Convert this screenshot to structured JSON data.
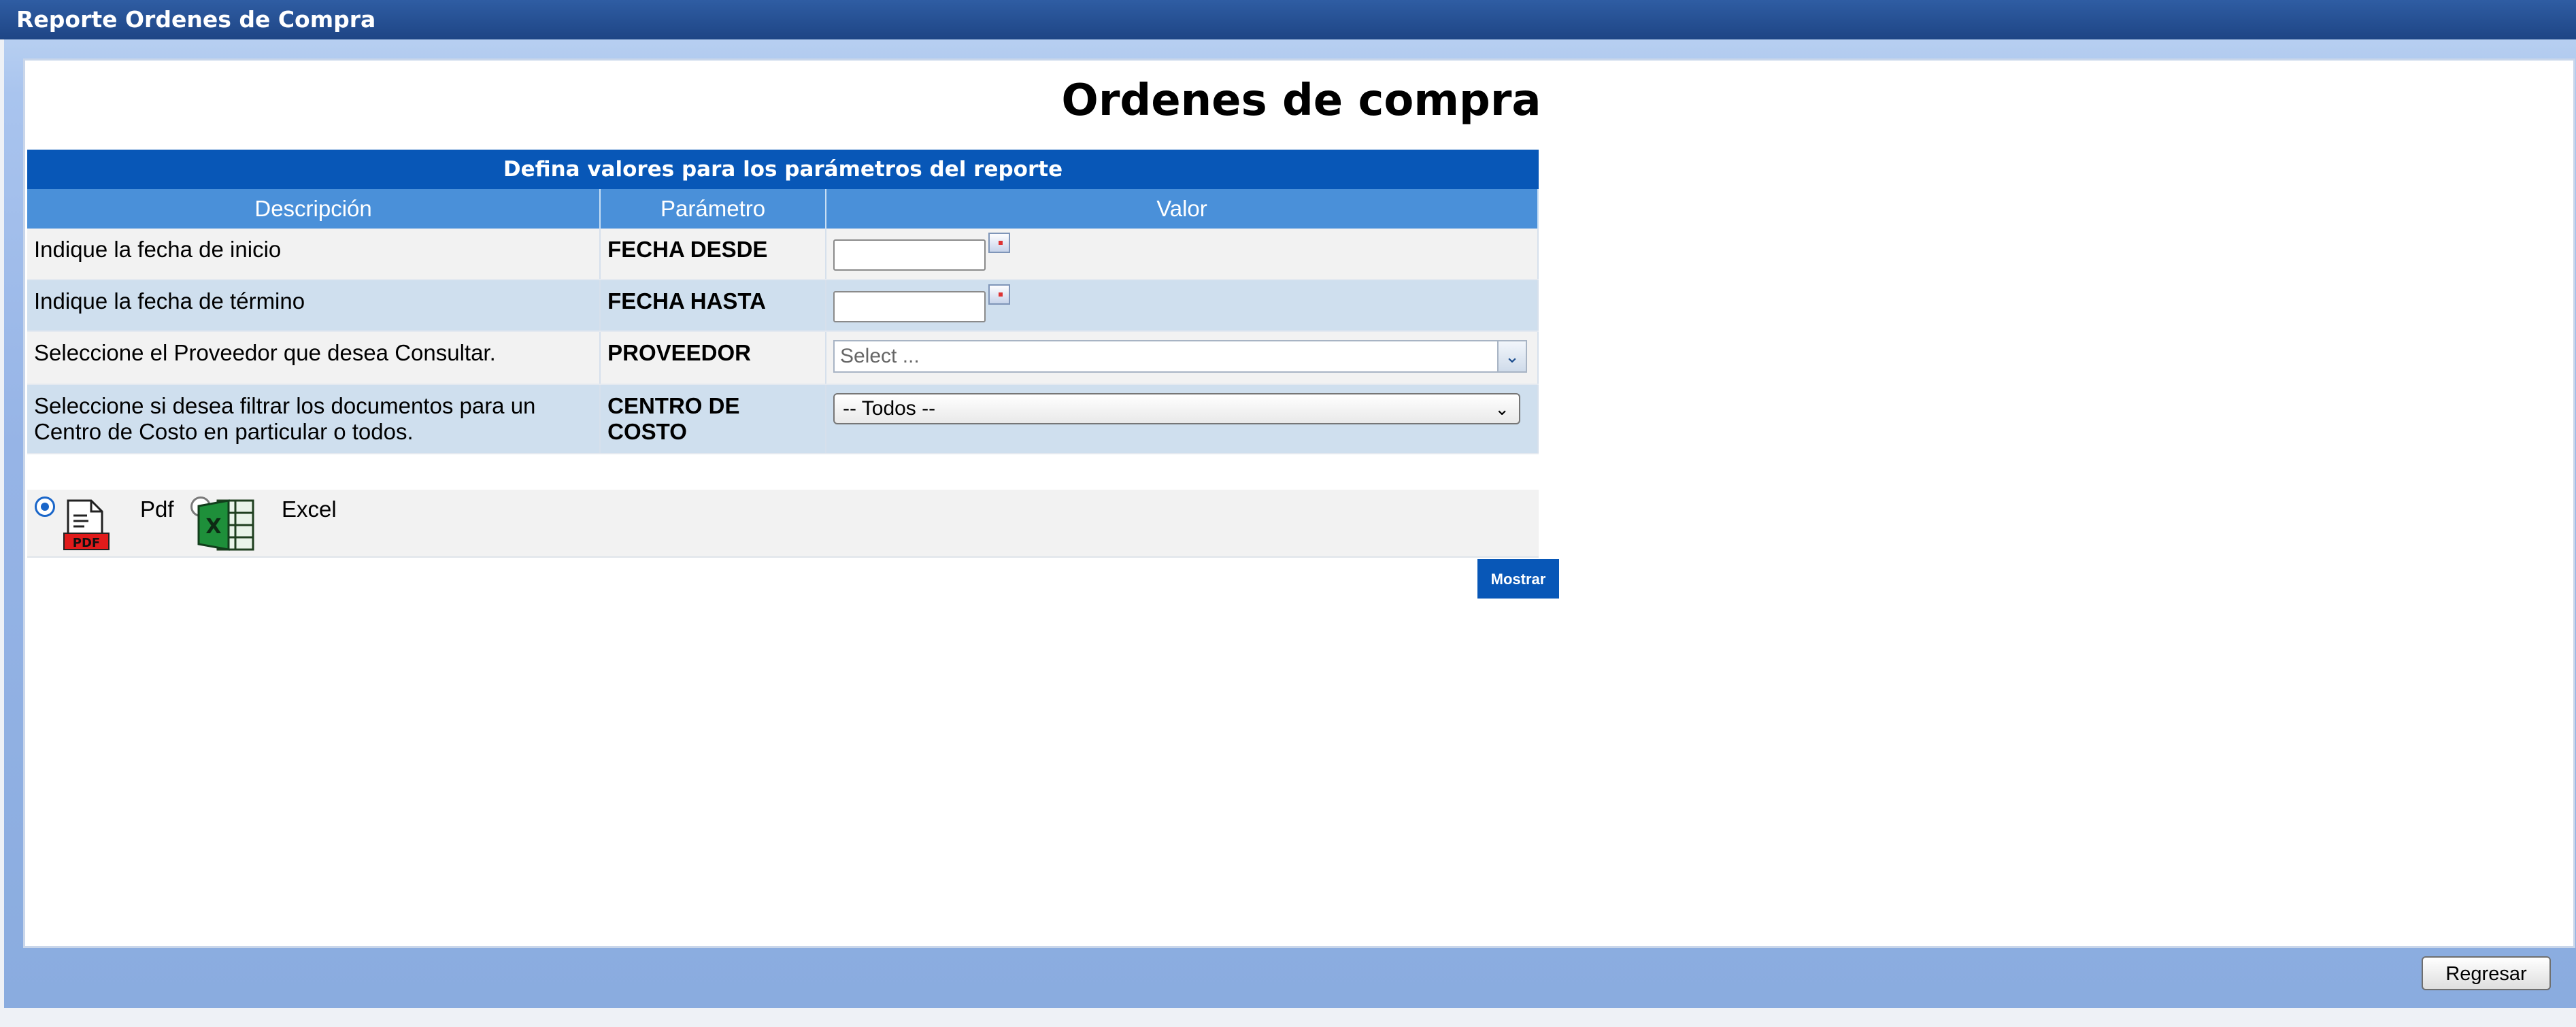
{
  "window": {
    "title": "Reporte Ordenes de Compra"
  },
  "page": {
    "title": "Ordenes de compra"
  },
  "params": {
    "header": "Defina valores para los parámetros del reporte",
    "columns": [
      "Descripción",
      "Parámetro",
      "Valor"
    ],
    "rows": [
      {
        "description": "Indique la fecha de inicio",
        "parameter": "FECHA DESDE",
        "value": ""
      },
      {
        "description": "Indique la fecha de término",
        "parameter": "FECHA HASTA",
        "value": ""
      },
      {
        "description": "Seleccione el Proveedor que desea Consultar.",
        "parameter": "PROVEEDOR",
        "placeholder": "Select ..."
      },
      {
        "description": "Seleccione si desea filtrar los documentos para un Centro de Costo en particular o todos.",
        "parameter": "CENTRO DE COSTO",
        "selected": "-- Todos --"
      }
    ]
  },
  "format": {
    "options": [
      {
        "label": "Pdf",
        "checked": true,
        "icon": "pdf-file-icon",
        "icon_text": "PDF"
      },
      {
        "label": "Excel",
        "checked": false,
        "icon": "excel-file-icon",
        "icon_text": "X"
      }
    ]
  },
  "actions": {
    "show_label": "Mostrar",
    "back_label": "Regresar"
  },
  "colors": {
    "header_blue": "#0857b7",
    "column_blue": "#4a90d9",
    "row_alt": "#cfdfee"
  }
}
